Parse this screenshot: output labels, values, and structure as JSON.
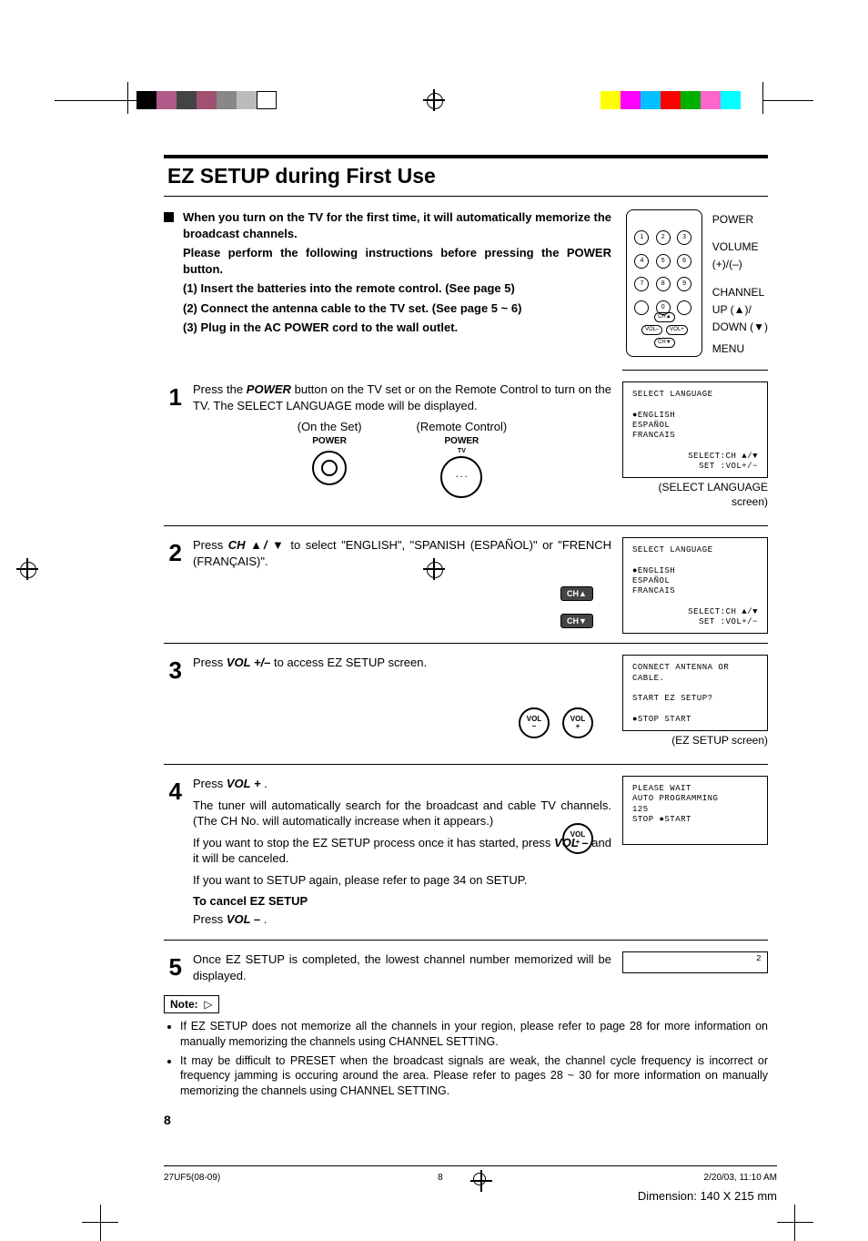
{
  "title": "EZ SETUP during First Use",
  "intro": {
    "l1": "When you turn on the TV for the first time, it will automatically memorize the broadcast channels.",
    "l2": "Please perform the following instructions before pressing the POWER button.",
    "l3": "(1) Insert the batteries into the remote control. (See page 5)",
    "l4": "(2) Connect the antenna cable to the TV set.  (See page 5 ~ 6)",
    "l5": "(3) Plug in the AC POWER cord to the wall outlet."
  },
  "remote_labels": {
    "power": "POWER",
    "volume": "VOLUME",
    "volume_sub": "(+)/(–)",
    "channel": "CHANNEL",
    "channel_sub1": "UP (▲)/",
    "channel_sub2": "DOWN (▼)",
    "menu": "MENU"
  },
  "buttons": {
    "ch_up": "CH▲",
    "ch_dn": "CH▼",
    "vol_minus": "VOL\n–",
    "vol_plus": "VOL\n+",
    "power": "POWER",
    "power_tv": "TV"
  },
  "step1": {
    "num": "1",
    "text_a": "Press the ",
    "text_b": "POWER",
    "text_c": " button on the TV set or on the Remote Control to turn on the TV. The SELECT LANGUAGE mode will be displayed.",
    "onset": "(On the Set)",
    "remote": "(Remote Control)"
  },
  "step2": {
    "num": "2",
    "text_a": "Press ",
    "text_b": "CH ▲/ ▼",
    "text_c": " to select \"ENGLISH\", \"SPANISH (ESPAÑOL)\" or \"FRENCH (FRANÇAIS)\"."
  },
  "step3": {
    "num": "3",
    "text_a": "Press ",
    "text_b": "VOL +/–",
    "text_c": " to access EZ SETUP screen."
  },
  "step4": {
    "num": "4",
    "text_a": "Press ",
    "text_b": "VOL + ",
    "text_c": ".",
    "p2": "The tuner will automatically search for the broadcast and cable TV channels. (The CH No. will automatically increase when it appears.)",
    "p3a": "If you want to stop the EZ SETUP process once it has started, press ",
    "p3b": "VOL –",
    "p3c": "  and it will be canceled.",
    "p4": "If you want to SETUP again, please refer to page 34 on SETUP.",
    "cancel1": "To cancel EZ SETUP",
    "cancel2a": "Press ",
    "cancel2b": "VOL – ",
    "cancel2c": "."
  },
  "step5": {
    "num": "5",
    "text": "Once EZ SETUP is completed, the lowest channel number memorized will be displayed.",
    "screen_num": "2"
  },
  "screens": {
    "lang": {
      "title": "SELECT LANGUAGE",
      "opt1": "●ENGLISH",
      "opt2": " ESPAÑOL",
      "opt3": " FRANCAIS",
      "hint1": "SELECT:CH ▲/▼",
      "hint2": "SET   :VOL+/−",
      "label": "(SELECT LANGUAGE screen)"
    },
    "ez": {
      "l1": "CONNECT ANTENNA OR CABLE.",
      "l2": "START EZ SETUP?",
      "l3": "●STOP    START",
      "label": "(EZ SETUP screen)"
    },
    "prog": {
      "l1": "PLEASE WAIT",
      "l2": "AUTO PROGRAMMING",
      "l3": "125",
      "l4": " STOP   ●START"
    }
  },
  "note_label": "Note:",
  "notes": {
    "n1": "If EZ SETUP does not memorize all the channels in your region, please refer to page 28 for more information on manually memorizing the channels using CHANNEL SETTING.",
    "n2": "It may be difficult to PRESET when the broadcast signals are weak, the channel cycle frequency is incorrect or frequency jamming is occuring around the area. Please refer to pages 28 ~ 30 for more information on manually memorizing the channels using CHANNEL SETTING."
  },
  "page_number": "8",
  "footer": {
    "file": "27UF5(08-09)",
    "page": "8",
    "datetime": "2/20/03, 11:10 AM",
    "dimension": "Dimension: 140  X 215 mm"
  }
}
